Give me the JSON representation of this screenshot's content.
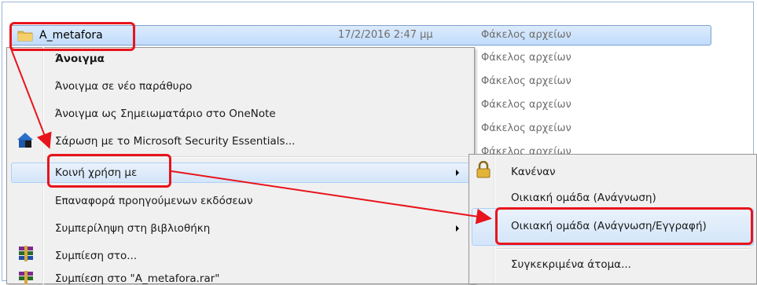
{
  "folder": {
    "name": "A_metafora",
    "date": "17/2/2016 2:47 μμ",
    "type": "Φάκελος αρχείων"
  },
  "type_column": [
    "Φάκελος αρχείων",
    "Φάκελος αρχείων",
    "Φάκελος αρχείων",
    "Φάκελος αρχείων",
    "Φάκελος αρχείων"
  ],
  "context_menu": {
    "open": "Άνοιγμα",
    "open_new_window": "Άνοιγμα σε νέο παράθυρο",
    "open_onenote": "Άνοιγμα ως Σημειωματάριο στο OneNote",
    "scan_mse": "Σάρωση με το Microsoft Security Essentials...",
    "share_with": "Κοινή χρήση με",
    "restore_versions": "Επαναφορά προηγούμενων εκδόσεων",
    "include_library": "Συμπερίληψη στη βιβλιοθήκη",
    "compress_to": "Συμπίεση στο...",
    "compress_rar": "Συμπίεση στο \"A_metafora.rar\""
  },
  "share_submenu": {
    "nobody": "Κανέναν",
    "homegroup_read": "Οικιακή ομάδα (Ανάγνωση)",
    "homegroup_readwrite": "Οικιακή ομάδα (Ανάγνωση/Εγγραφή)",
    "specific_people": "Συγκεκριμένα άτομα..."
  },
  "colors": {
    "annotation": "#e8141c",
    "selection": "#c1dcfc",
    "menu_bg": "#f0f0f0"
  },
  "icons": {
    "folder": "folder-icon",
    "mse": "security-essentials-icon",
    "lock": "lock-icon",
    "winrar": "winrar-icon",
    "submenu": "submenu-arrow-icon"
  }
}
